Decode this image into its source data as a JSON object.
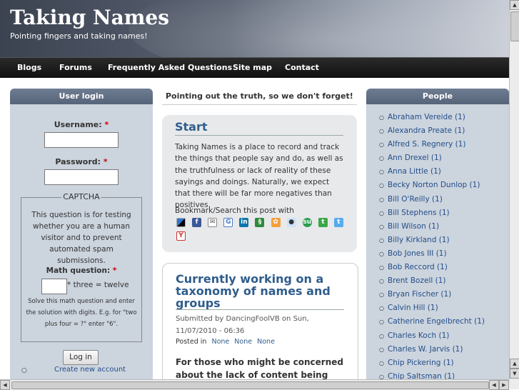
{
  "header": {
    "site_title": "Taking Names",
    "slogan": "Pointing fingers and taking names!"
  },
  "nav": {
    "items": [
      {
        "label": "Blogs"
      },
      {
        "label": "Forums"
      },
      {
        "label": "Frequently Asked Questions"
      },
      {
        "label": "Site map"
      },
      {
        "label": "Contact"
      }
    ]
  },
  "login": {
    "title": "User login",
    "username_label": "Username:",
    "password_label": "Password:",
    "required_mark": "*",
    "captcha_legend": "CAPTCHA",
    "captcha_description": "This question is for testing whether you are a human visitor and to prevent automated spam submissions.",
    "math_label": "Math question:",
    "math_question": "* three = twelve",
    "math_help": "Solve this math question and enter the solution with digits. E.g. for \"two plus four = ?\" enter \"6\".",
    "login_button": "Log in",
    "create_account": "Create new account"
  },
  "main": {
    "tagline": "Pointing out the truth, so we don't forget!",
    "start": {
      "title": "Start",
      "body": "Taking Names is a place to record and track the things that people say and do, as well as the truthfulness or lack of reality of these sayings and doings. Naturally, we expect that there will be far more negatives than positives.",
      "bookmark_label": "Bookmark/Search this post with"
    },
    "post": {
      "title": "Currently working on a taxonomy of names and groups",
      "submitted": "Submitted by DancingFoolVB on Sun, 11/07/2010 - 06:36",
      "posted_in": "Posted in",
      "terms": [
        "None",
        "None",
        "None"
      ],
      "heading": "For those who might be concerned about the lack of content being"
    }
  },
  "people": {
    "title": "People",
    "names": [
      "Abraham Vereide (1)",
      "Alexandra Preate (1)",
      "Alfred S. Regnery (1)",
      "Ann Drexel (1)",
      "Anna Little (1)",
      "Becky Norton Dunlop (1)",
      "Bill O'Reilly (1)",
      "Bill Stephens (1)",
      "Bill Wilson (1)",
      "Billy Kirkland (1)",
      "Bob Jones III (1)",
      "Bob Reccord (1)",
      "Brent Bozell (1)",
      "Bryan Fischer (1)",
      "Calvin Hill (1)",
      "Catherine Engelbrecht (1)",
      "Charles Koch (1)",
      "Charles W. Jarvis (1)",
      "Chip Pickering (1)",
      "Chip Saltsman (1)"
    ]
  },
  "bookmark_icons": [
    "delicious-icon",
    "facebook-icon",
    "email-icon",
    "google-icon",
    "linkedin-icon",
    "evernote-icon",
    "mixx-icon",
    "reddit-icon",
    "stumbleupon-icon",
    "technorati-icon",
    "twitter-icon",
    "yahoo-icon"
  ],
  "colors": {
    "link": "#2f5d8c",
    "sidebar_bg": "#ccd4de",
    "block_header": "#5e6c82",
    "nav_bg": "#1a1a1a"
  }
}
